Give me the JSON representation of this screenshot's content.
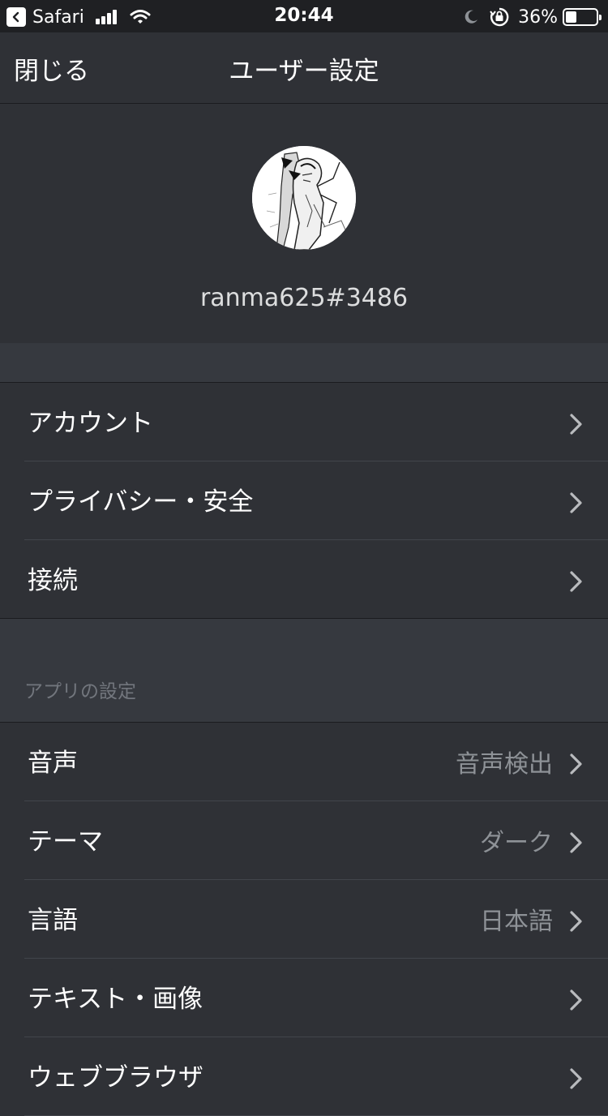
{
  "status_bar": {
    "app": "Safari",
    "time": "20:44",
    "battery_percent": "36%",
    "battery_level": 0.36,
    "icons": [
      "back-icon",
      "signal-icon",
      "wifi-icon",
      "moon-icon",
      "rotation-lock-icon",
      "battery-icon"
    ]
  },
  "nav": {
    "close_label": "閉じる",
    "title": "ユーザー設定"
  },
  "profile": {
    "username": "ranma625#3486"
  },
  "account_settings": [
    {
      "label": "アカウント"
    },
    {
      "label": "プライバシー・安全"
    },
    {
      "label": "接続"
    }
  ],
  "app_settings": {
    "header": "アプリの設定",
    "items": [
      {
        "label": "音声",
        "value": "音声検出"
      },
      {
        "label": "テーマ",
        "value": "ダーク"
      },
      {
        "label": "言語",
        "value": "日本語"
      },
      {
        "label": "テキスト・画像",
        "value": ""
      },
      {
        "label": "ウェブブラウザ",
        "value": ""
      }
    ]
  },
  "colors": {
    "background": "#2f3136",
    "section_gap": "#36393f",
    "status_bar": "#1f2023",
    "secondary_text": "#8e9297",
    "chevron": "#b9bbbe"
  }
}
